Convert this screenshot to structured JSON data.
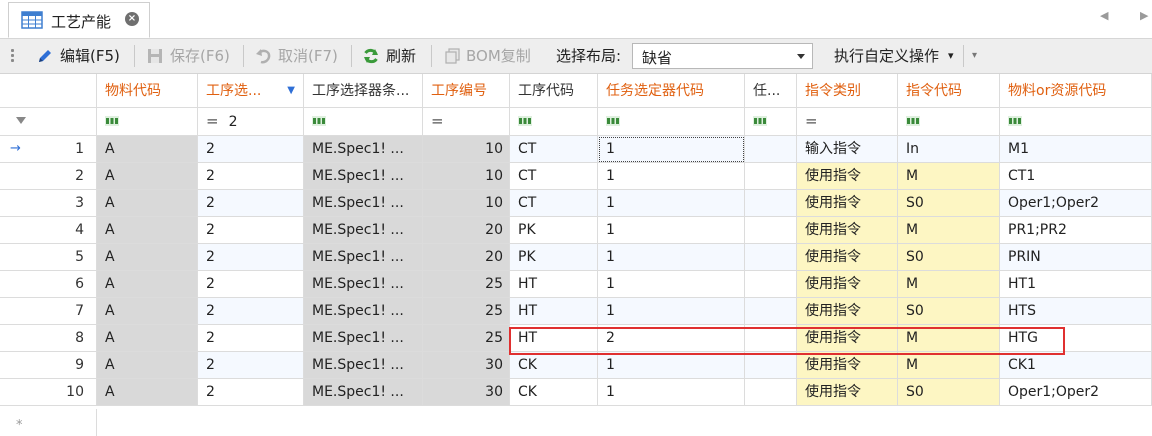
{
  "tab": {
    "label": "工艺产能",
    "close": "×",
    "icon": "grid-icon"
  },
  "toolbar": {
    "edit": "编辑(F5)",
    "save": "保存(F6)",
    "cancel": "取消(F7)",
    "refresh": "刷新",
    "bom": "BOM复制",
    "layout_label": "选择布局:",
    "layout_value": "缺省",
    "custom_action": "执行自定义操作",
    "custom_action_caret": "▾"
  },
  "colors": {
    "header_text": "#e06010",
    "header_dark": "#333333",
    "row_light": "#f5f9ff",
    "row_white": "#ffffff",
    "gray_col": "#d9d9d9",
    "yellow_col": "#fdf6c3",
    "highlight_border": "#e03030",
    "blue_indicator": "#2f6fd6"
  },
  "grid": {
    "columns": [
      {
        "key": "material",
        "label": "物料代码",
        "color": "orange"
      },
      {
        "key": "process_sel",
        "label": "工序选...",
        "color": "orange",
        "filtered": true
      },
      {
        "key": "process_cond",
        "label": "工序选择器条...",
        "color": "dark"
      },
      {
        "key": "process_no",
        "label": "工序编号",
        "color": "orange"
      },
      {
        "key": "process_code",
        "label": "工序代码",
        "color": "dark"
      },
      {
        "key": "task_sel",
        "label": "任务选定器代码",
        "color": "orange"
      },
      {
        "key": "task",
        "label": "任...",
        "color": "dark"
      },
      {
        "key": "cmd_type",
        "label": "指令类别",
        "color": "orange"
      },
      {
        "key": "cmd_code",
        "label": "指令代码",
        "color": "orange"
      },
      {
        "key": "resource",
        "label": "物料or资源代码",
        "color": "orange"
      }
    ],
    "filter": {
      "process_sel_op": "=",
      "process_sel_value": "2",
      "process_no_op": "=",
      "cmd_type_op": "="
    },
    "rows": [
      {
        "n": "1",
        "material": "A",
        "process_sel": "2",
        "process_cond": "ME.Spec1! ...",
        "process_no": "10",
        "process_code": "CT",
        "task_sel": "1",
        "cmd_type": "输入指令",
        "cmd_code": "In",
        "resource": "M1"
      },
      {
        "n": "2",
        "material": "A",
        "process_sel": "2",
        "process_cond": "ME.Spec1! ...",
        "process_no": "10",
        "process_code": "CT",
        "task_sel": "1",
        "cmd_type": "使用指令",
        "cmd_code": "M",
        "resource": "CT1"
      },
      {
        "n": "3",
        "material": "A",
        "process_sel": "2",
        "process_cond": "ME.Spec1! ...",
        "process_no": "10",
        "process_code": "CT",
        "task_sel": "1",
        "cmd_type": "使用指令",
        "cmd_code": "S0",
        "resource": "Oper1;Oper2"
      },
      {
        "n": "4",
        "material": "A",
        "process_sel": "2",
        "process_cond": "ME.Spec1! ...",
        "process_no": "20",
        "process_code": "PK",
        "task_sel": "1",
        "cmd_type": "使用指令",
        "cmd_code": "M",
        "resource": "PR1;PR2"
      },
      {
        "n": "5",
        "material": "A",
        "process_sel": "2",
        "process_cond": "ME.Spec1! ...",
        "process_no": "20",
        "process_code": "PK",
        "task_sel": "1",
        "cmd_type": "使用指令",
        "cmd_code": "S0",
        "resource": "PRIN"
      },
      {
        "n": "6",
        "material": "A",
        "process_sel": "2",
        "process_cond": "ME.Spec1! ...",
        "process_no": "25",
        "process_code": "HT",
        "task_sel": "1",
        "cmd_type": "使用指令",
        "cmd_code": "M",
        "resource": "HT1"
      },
      {
        "n": "7",
        "material": "A",
        "process_sel": "2",
        "process_cond": "ME.Spec1! ...",
        "process_no": "25",
        "process_code": "HT",
        "task_sel": "1",
        "cmd_type": "使用指令",
        "cmd_code": "S0",
        "resource": "HTS"
      },
      {
        "n": "8",
        "material": "A",
        "process_sel": "2",
        "process_cond": "ME.Spec1! ...",
        "process_no": "25",
        "process_code": "HT",
        "task_sel": "2",
        "cmd_type": "使用指令",
        "cmd_code": "M",
        "resource": "HTG"
      },
      {
        "n": "9",
        "material": "A",
        "process_sel": "2",
        "process_cond": "ME.Spec1! ...",
        "process_no": "30",
        "process_code": "CK",
        "task_sel": "1",
        "cmd_type": "使用指令",
        "cmd_code": "M",
        "resource": "CK1"
      },
      {
        "n": "10",
        "material": "A",
        "process_sel": "2",
        "process_cond": "ME.Spec1! ...",
        "process_no": "30",
        "process_code": "CK",
        "task_sel": "1",
        "cmd_type": "使用指令",
        "cmd_code": "S0",
        "resource": "Oper1;Oper2"
      }
    ],
    "current_row_indicator": "→",
    "new_row_indicator": "*"
  }
}
